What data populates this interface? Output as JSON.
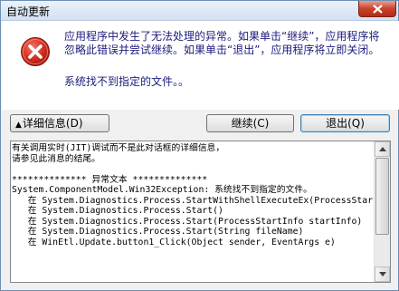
{
  "window": {
    "title": "自动更新"
  },
  "message": {
    "text": "应用程序中发生了无法处理的异常。如果单击“继续”，应用程序将忽略此错误并尝试继续。如果单击“退出”，应用程序将立即关闭。",
    "detail": "系统找不到指定的文件。。"
  },
  "buttons": {
    "details_label": "详细信息(D)",
    "continue_label": "继续(C)",
    "exit_label": "退出(Q)"
  },
  "details": {
    "text": "有关调用实时(JIT)调试而不是此对话框的详细信息，\n请参见此消息的结尾。\n\n************** 异常文本 **************\nSystem.ComponentModel.Win32Exception: 系统找不到指定的文件。\n   在 System.Diagnostics.Process.StartWithShellExecuteEx(ProcessStart\n   在 System.Diagnostics.Process.Start()\n   在 System.Diagnostics.Process.Start(ProcessStartInfo startInfo)\n   在 System.Diagnostics.Process.Start(String fileName)\n   在 WinEtl.Update.button1_Click(Object sender, EventArgs e)"
  },
  "icons": {
    "error": "error-icon",
    "close": "close-icon",
    "expand": "up-triangle-icon"
  },
  "colors": {
    "error_red": "#d72f1f",
    "message_text": "#1c1c7c",
    "close_button": "#c8432e"
  }
}
